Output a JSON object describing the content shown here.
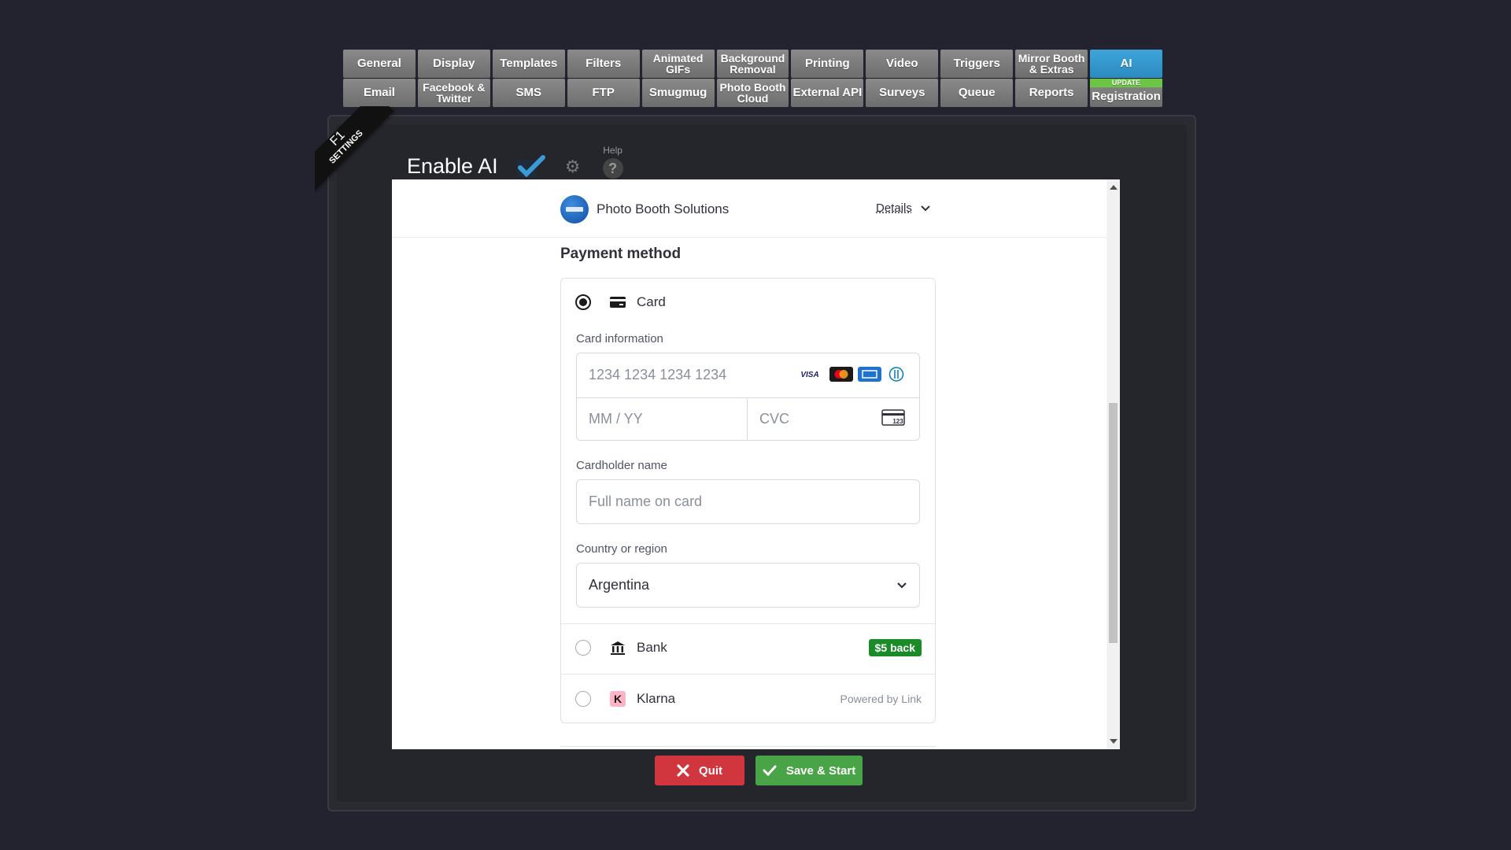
{
  "tabs": {
    "row1": [
      "General",
      "Display",
      "Templates",
      "Filters",
      "Animated GIFs",
      "Background Removal",
      "Printing",
      "Video",
      "Triggers",
      "Mirror Booth & Extras",
      "AI"
    ],
    "row2": [
      "Email",
      "Facebook & Twitter",
      "SMS",
      "FTP",
      "Smugmug",
      "Photo Booth Cloud",
      "External API",
      "Surveys",
      "Queue",
      "Reports",
      "Registration"
    ],
    "active": "AI",
    "update_badge": "UPDATE"
  },
  "ribbon": {
    "key": "F1",
    "text": "SETTINGS"
  },
  "enable": {
    "label": "Enable AI",
    "checked": true,
    "help_label": "Help",
    "help_symbol": "?"
  },
  "checkout": {
    "merchant_name": "Photo Booth Solutions",
    "details_label": "Details",
    "payment_method_title": "Payment method",
    "card_option": {
      "label": "Card",
      "selected": true
    },
    "card_information_label": "Card information",
    "card_number_placeholder": "1234 1234 1234 1234",
    "expiry_placeholder": "MM / YY",
    "cvc_placeholder": "CVC",
    "card_brands": [
      "visa",
      "mastercard",
      "amex",
      "diners"
    ],
    "cardholder_label": "Cardholder name",
    "cardholder_placeholder": "Full name on card",
    "country_label": "Country or region",
    "country_value": "Argentina",
    "bank_option": {
      "label": "Bank",
      "promo": "$5 back",
      "selected": false
    },
    "klarna_option": {
      "label": "Klarna",
      "note": "Powered by Link",
      "selected": false
    }
  },
  "buttons": {
    "quit": "Quit",
    "save": "Save & Start"
  },
  "colors": {
    "background": "#23232f",
    "tab": "#7a7a7a",
    "tab_active": "#3399cc",
    "update_badge": "#6cc644",
    "quit": "#d1363f",
    "save": "#49a447",
    "promo": "#1b8a28",
    "checkmark": "#3b9bd6"
  }
}
